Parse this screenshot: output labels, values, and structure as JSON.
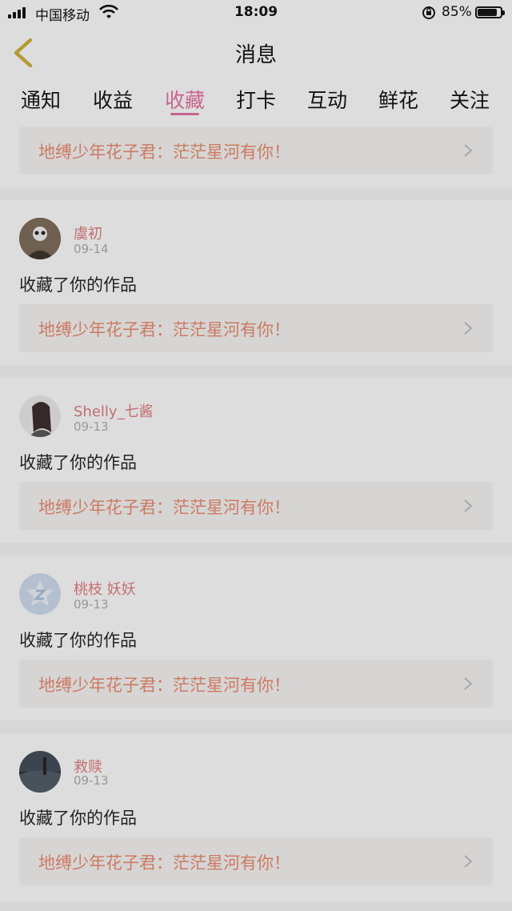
{
  "status_bar": {
    "carrier": "中国移动",
    "time": "18:09",
    "battery_percent": "85%",
    "battery_level": 0.85,
    "icons": [
      "signal-icon",
      "wifi-icon",
      "rotation-lock-icon",
      "battery-icon"
    ]
  },
  "header": {
    "title": "消息",
    "back_icon": "chevron-left-icon"
  },
  "tabs": [
    {
      "label": "通知",
      "active": false
    },
    {
      "label": "收益",
      "active": false
    },
    {
      "label": "收藏",
      "active": true
    },
    {
      "label": "打卡",
      "active": false
    },
    {
      "label": "互动",
      "active": false
    },
    {
      "label": "鲜花",
      "active": false
    },
    {
      "label": "关注",
      "active": false
    }
  ],
  "colors": {
    "accent": "#e0709e",
    "work_title": "#e6886b",
    "username": "#d97a7a"
  },
  "top_item": {
    "work_title": "地缚少年花子君：茫茫星河有你！"
  },
  "items": [
    {
      "user": "虞初",
      "date": "09-14",
      "action": "收藏了你的作品",
      "work_title": "地缚少年花子君：茫茫星河有你！"
    },
    {
      "user": "Shelly_七酱",
      "date": "09-13",
      "action": "收藏了你的作品",
      "work_title": "地缚少年花子君：茫茫星河有你！"
    },
    {
      "user": "桃枝 妖妖",
      "date": "09-13",
      "action": "收藏了你的作品",
      "work_title": "地缚少年花子君：茫茫星河有你！"
    },
    {
      "user": "救赎",
      "date": "09-13",
      "action": "收藏了你的作品",
      "work_title": "地缚少年花子君：茫茫星河有你！"
    }
  ]
}
